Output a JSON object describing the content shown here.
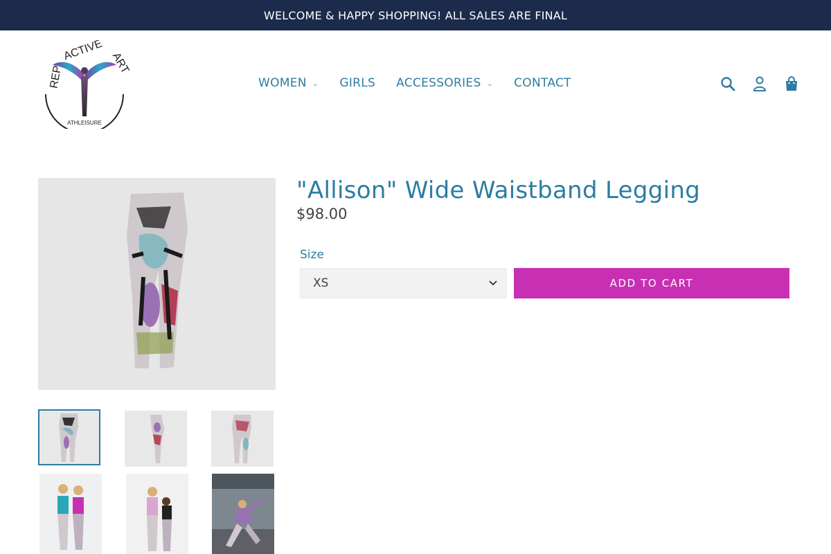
{
  "announcement": "WELCOME & HAPPY SHOPPING! ALL SALES ARE FINAL",
  "logo": {
    "arc_text": "REP ACTIVE ART",
    "sub_text": "ATHLEISURE"
  },
  "nav": {
    "items": [
      {
        "label": "WOMEN",
        "has_dropdown": true
      },
      {
        "label": "GIRLS",
        "has_dropdown": false
      },
      {
        "label": "ACCESSORIES",
        "has_dropdown": true
      },
      {
        "label": "CONTACT",
        "has_dropdown": false
      }
    ]
  },
  "header_icons": [
    "search-icon",
    "account-icon",
    "cart-icon"
  ],
  "product": {
    "title": "\"Allison\" Wide Waistband Legging",
    "price": "$98.00",
    "size_label": "Size",
    "size_selected": "XS",
    "add_to_cart": "ADD TO CART"
  },
  "colors": {
    "announcement_bg": "#1c2b4b",
    "link": "#2c7ca3",
    "add_to_cart_bg": "#c830b4"
  }
}
